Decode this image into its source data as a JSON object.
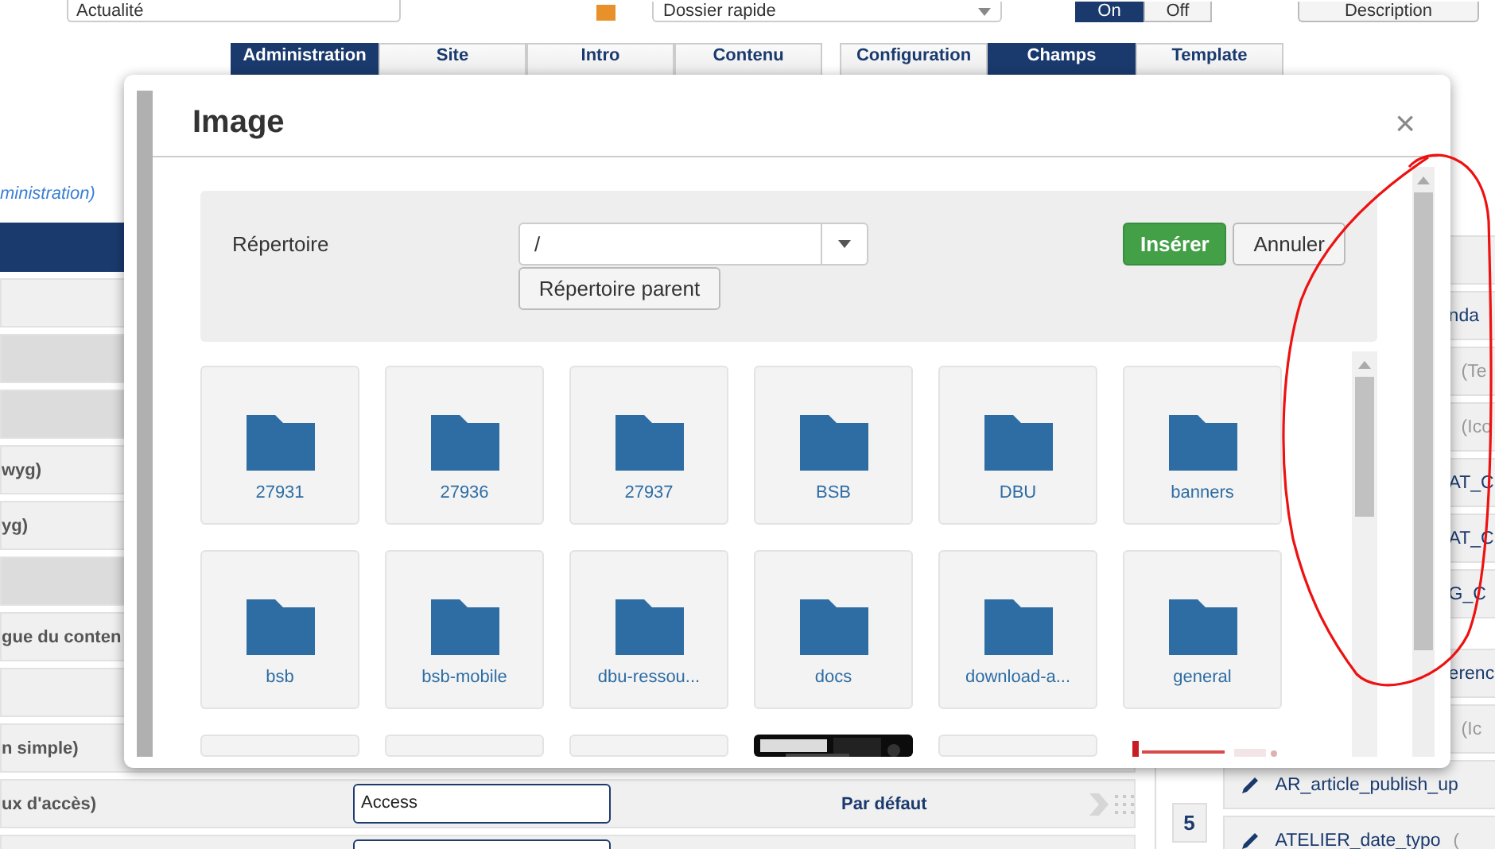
{
  "top_bar": {
    "title_field": {
      "value": "Actualité"
    },
    "folder_select": {
      "value": "Dossier rapide"
    },
    "toggle": [
      {
        "label": "On",
        "selected": true
      },
      {
        "label": "Off",
        "selected": false
      }
    ],
    "description_button": "Description"
  },
  "tab_groups": [
    {
      "tabs": [
        {
          "label": "Administration",
          "selected": true
        },
        {
          "label": "Site",
          "selected": false
        },
        {
          "label": "Intro",
          "selected": false
        },
        {
          "label": "Contenu",
          "selected": false
        }
      ]
    },
    {
      "tabs": [
        {
          "label": "Configuration",
          "selected": false
        },
        {
          "label": "Champs",
          "selected": true
        },
        {
          "label": "Template",
          "selected": false
        }
      ]
    }
  ],
  "left_panel": {
    "link": "ministration)",
    "rows": [
      {
        "kind": "header"
      },
      {
        "kind": "plain",
        "highlighted": false
      },
      {
        "kind": "plain",
        "highlighted": true
      },
      {
        "kind": "plain",
        "highlighted": true
      },
      {
        "kind": "plain",
        "label": "wyg)",
        "highlighted": false
      },
      {
        "kind": "plain",
        "label": "yg)",
        "highlighted": false
      },
      {
        "kind": "plain",
        "highlighted": true
      },
      {
        "kind": "plain",
        "label": "gue du conten",
        "highlighted": false
      },
      {
        "kind": "plain",
        "highlighted": false
      },
      {
        "kind": "plain",
        "label": "n simple)",
        "highlighted": false
      },
      {
        "kind": "field",
        "label": "ux d'accès)",
        "field": {
          "value": "Access"
        },
        "default_label": "Par défaut",
        "highlighted": false
      },
      {
        "kind": "field",
        "field": {},
        "highlighted": false
      }
    ]
  },
  "right_panel": {
    "badge": "5",
    "groups": [
      {
        "rows": [
          {
            "kind": "plain"
          },
          {
            "kind": "plain",
            "label": "nda"
          },
          {
            "kind": "muted",
            "label": "(Te"
          },
          {
            "kind": "muted",
            "label": "(Ico"
          },
          {
            "kind": "plain",
            "label": "AT_C"
          },
          {
            "kind": "plain",
            "label": "AT_C"
          },
          {
            "kind": "plain",
            "label": "G_C"
          }
        ]
      },
      {
        "rows": [
          {
            "kind": "plain",
            "label": "erenc"
          },
          {
            "kind": "muted",
            "label": "(Ic"
          },
          {
            "kind": "edit",
            "label": "AR_article_publish_up"
          },
          {
            "kind": "edit",
            "label": "ATELIER_date_typo",
            "note": "("
          }
        ]
      }
    ]
  },
  "modal": {
    "title": "Image",
    "close": "×",
    "directory_label": "Répertoire",
    "directory_value": "/",
    "parent_button": "Répertoire parent",
    "insert_button": "Insérer",
    "cancel_button": "Annuler",
    "items": [
      {
        "kind": "folder",
        "name": "27931"
      },
      {
        "kind": "folder",
        "name": "27936"
      },
      {
        "kind": "folder",
        "name": "27937"
      },
      {
        "kind": "folder",
        "name": "BSB"
      },
      {
        "kind": "folder",
        "name": "DBU"
      },
      {
        "kind": "folder",
        "name": "banners"
      },
      {
        "kind": "folder",
        "name": "bsb"
      },
      {
        "kind": "folder",
        "name": "bsb-mobile"
      },
      {
        "kind": "folder",
        "name": "dbu-ressou..."
      },
      {
        "kind": "folder",
        "name": "docs"
      },
      {
        "kind": "folder",
        "name": "download-a..."
      },
      {
        "kind": "folder",
        "name": "general"
      },
      {
        "kind": "folder"
      },
      {
        "kind": "folder"
      },
      {
        "kind": "folder"
      },
      {
        "kind": "picture"
      },
      {
        "kind": "folder"
      },
      {
        "kind": "picture"
      }
    ]
  },
  "annotations": [
    {
      "kind": "freehand-circle"
    }
  ]
}
